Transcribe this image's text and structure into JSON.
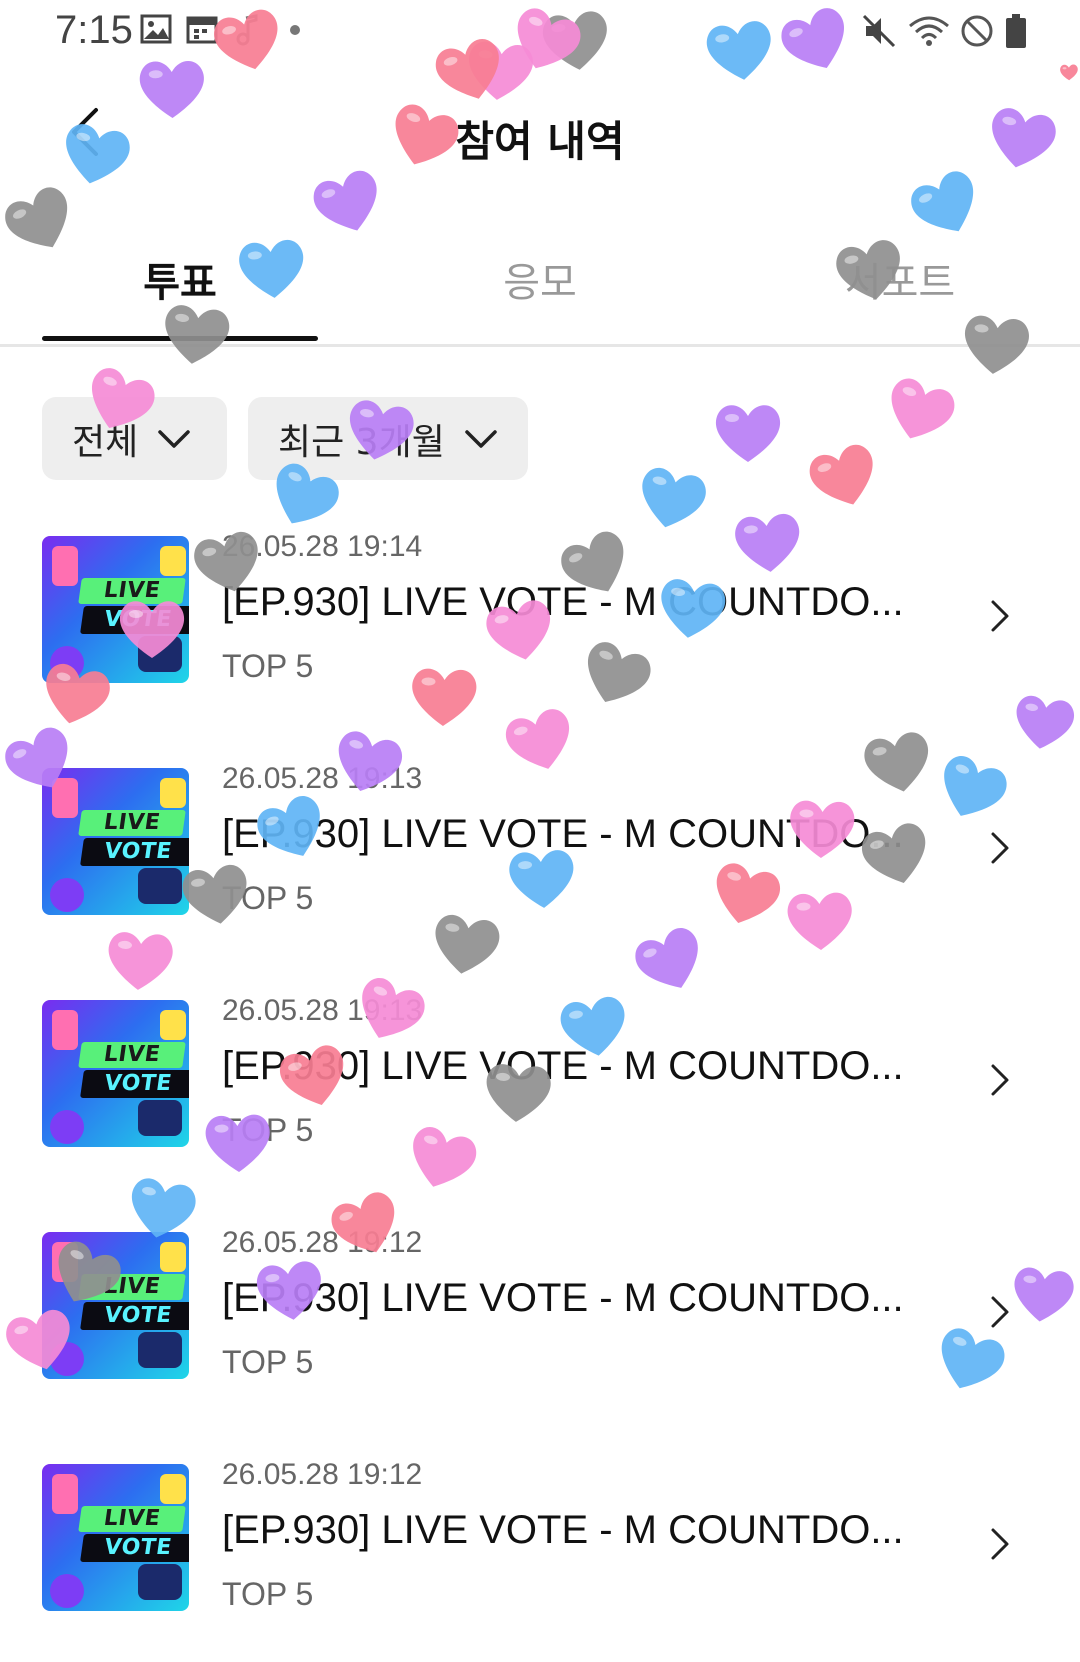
{
  "status_bar": {
    "time": "7:15",
    "left_icons": [
      "image-icon",
      "calendar-icon",
      "music-note-icon",
      "dot-icon"
    ],
    "right_icons": [
      "mute-icon",
      "wifi-icon",
      "do-not-disturb-icon",
      "battery-icon"
    ]
  },
  "header": {
    "title": "참여 내역",
    "back_icon": "chevron-left-icon"
  },
  "tabs": [
    {
      "label": "투표",
      "active": true
    },
    {
      "label": "응모",
      "active": false
    },
    {
      "label": "서포트",
      "active": false
    }
  ],
  "filters": [
    {
      "label": "전체"
    },
    {
      "label": "최근 3개월"
    }
  ],
  "items": [
    {
      "date": "26.05.28 19:14",
      "title": "[EP.930] LIVE VOTE - M COUNTDO...",
      "subtitle": "TOP 5",
      "thumb_line1": "LIVE",
      "thumb_line2": "VOTE"
    },
    {
      "date": "26.05.28 19:13",
      "title": "[EP.930] LIVE VOTE - M COUNTDO...",
      "subtitle": "TOP 5",
      "thumb_line1": "LIVE",
      "thumb_line2": "VOTE"
    },
    {
      "date": "26.05.28 19:13",
      "title": "[EP.930] LIVE VOTE - M COUNTDO...",
      "subtitle": "TOP 5",
      "thumb_line1": "LIVE",
      "thumb_line2": "VOTE"
    },
    {
      "date": "26.05.28 19:12",
      "title": "[EP.930] LIVE VOTE - M COUNTDO...",
      "subtitle": "TOP 5",
      "thumb_line1": "LIVE",
      "thumb_line2": "VOTE"
    },
    {
      "date": "26.05.28 19:12",
      "title": "[EP.930] LIVE VOTE - M COUNTDO...",
      "subtitle": "TOP 5",
      "thumb_line1": "LIVE",
      "thumb_line2": "VOTE"
    }
  ],
  "overlay": {
    "heart_colors": [
      "#8f8f8f",
      "#5fb4f5",
      "#b97ef5",
      "#f77d93",
      "#f58bd6"
    ]
  }
}
